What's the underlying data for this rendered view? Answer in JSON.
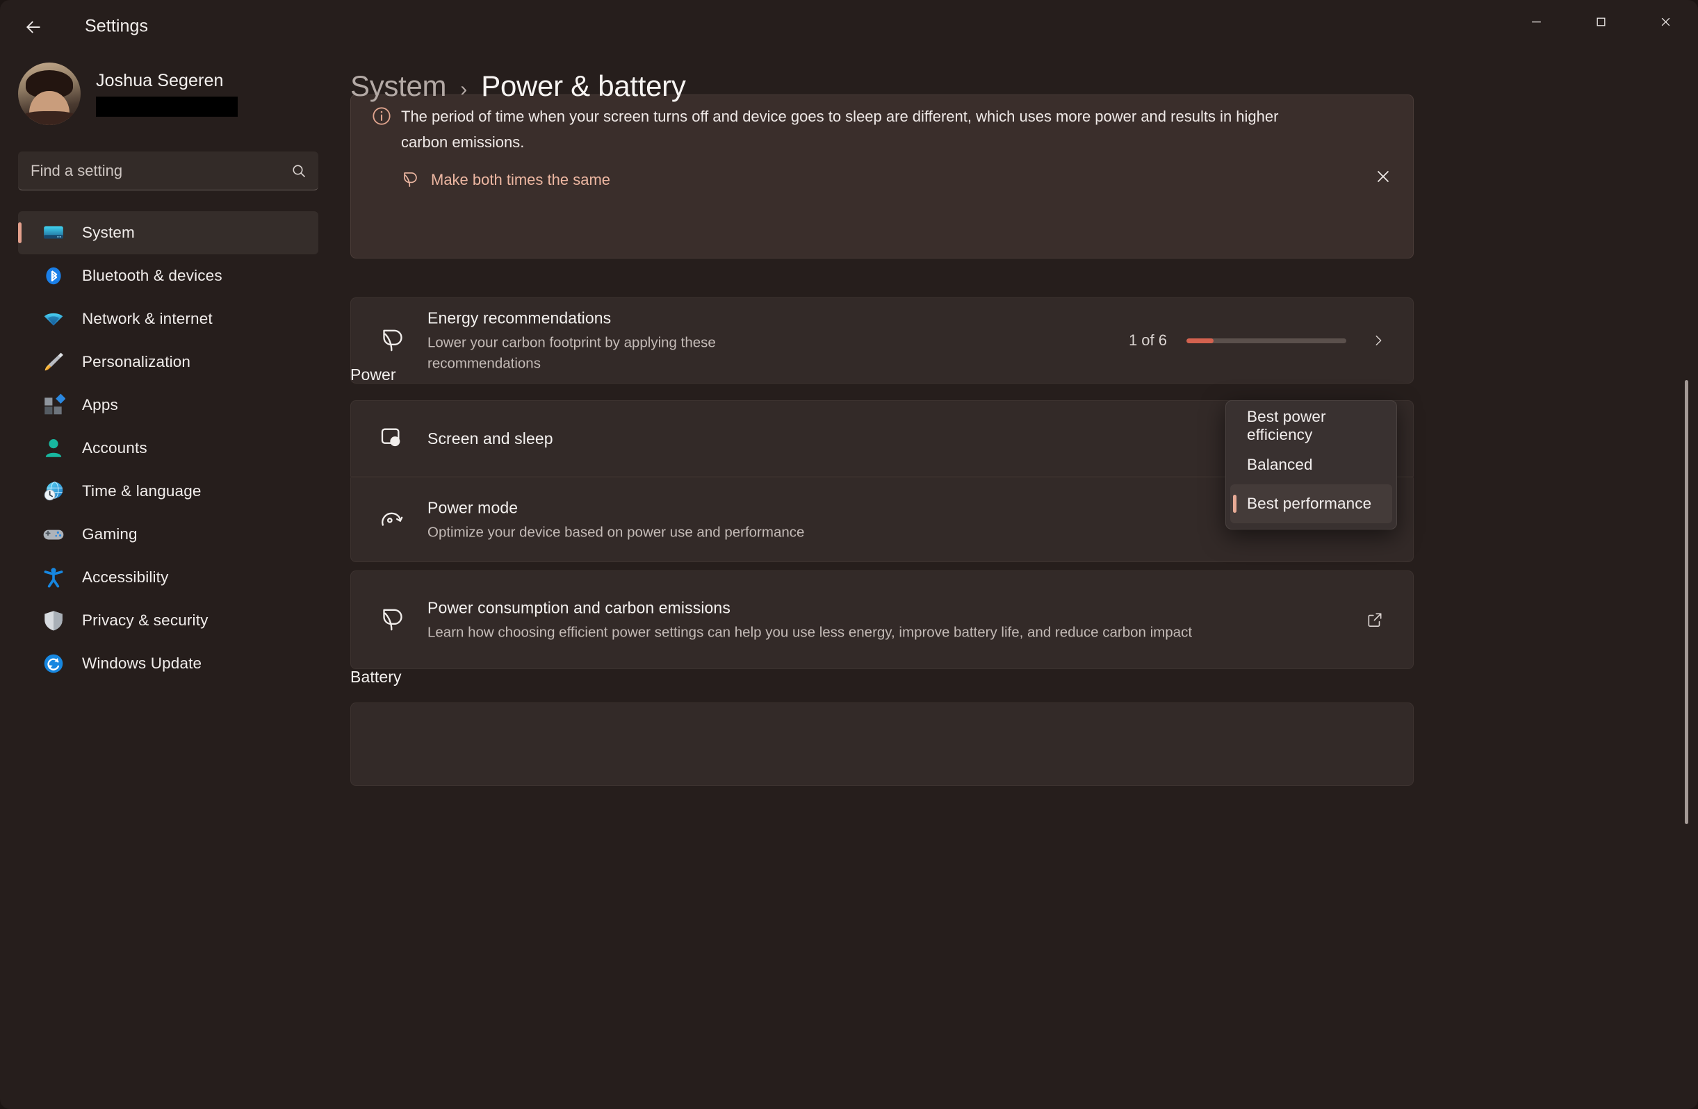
{
  "window": {
    "app_title": "Settings",
    "back_label": "Back",
    "minimize_label": "Minimize",
    "maximize_label": "Maximize",
    "close_label": "Close"
  },
  "colors": {
    "background": "#261e1c",
    "card": "#332a28",
    "accent": "#e3a08c",
    "progress_fill": "#d4624f",
    "info_link": "#edb7a2",
    "text_primary": "#f4f1ef",
    "text_secondary": "#c4bbb7"
  },
  "profile": {
    "name": "Joshua Segeren",
    "email_redacted": true
  },
  "search": {
    "placeholder": "Find a setting",
    "value": "",
    "icon": "search-icon"
  },
  "sidebar": {
    "items": [
      {
        "label": "System",
        "icon": "monitor-icon",
        "selected": true
      },
      {
        "label": "Bluetooth & devices",
        "icon": "bluetooth-icon",
        "selected": false
      },
      {
        "label": "Network & internet",
        "icon": "wifi-icon",
        "selected": false
      },
      {
        "label": "Personalization",
        "icon": "paintbrush-icon",
        "selected": false
      },
      {
        "label": "Apps",
        "icon": "apps-grid-icon",
        "selected": false
      },
      {
        "label": "Accounts",
        "icon": "person-icon",
        "selected": false
      },
      {
        "label": "Time & language",
        "icon": "clock-globe-icon",
        "selected": false
      },
      {
        "label": "Gaming",
        "icon": "gamepad-icon",
        "selected": false
      },
      {
        "label": "Accessibility",
        "icon": "accessibility-person-icon",
        "selected": false
      },
      {
        "label": "Privacy & security",
        "icon": "shield-icon",
        "selected": false
      },
      {
        "label": "Windows Update",
        "icon": "update-refresh-icon",
        "selected": false
      }
    ]
  },
  "breadcrumb": {
    "parent": "System",
    "separator": "›",
    "current": "Power & battery"
  },
  "infobar": {
    "icon": "info-icon",
    "message": "The period of time when your screen turns off and device goes to sleep are different, which uses more power and results in higher carbon emissions.",
    "action_label": "Make both times the same",
    "action_icon": "leaf-icon",
    "close_icon": "close-icon"
  },
  "energy_recommendations": {
    "icon": "leaf-icon",
    "title": "Energy recommendations",
    "subtitle": "Lower your carbon footprint by applying these recommendations",
    "progress_text": "1 of 6",
    "progress_applied": 1,
    "progress_total": 6,
    "progress_percent": 17,
    "chevron_icon": "chevron-right-icon"
  },
  "power_section": {
    "heading": "Power",
    "screen_and_sleep": {
      "icon": "screen-sleep-icon",
      "title": "Screen and sleep"
    },
    "power_mode": {
      "icon": "power-mode-icon",
      "title": "Power mode",
      "subtitle": "Optimize your device based on power use and performance",
      "selected_value": "Best performance"
    },
    "carbon": {
      "icon": "leaf-icon",
      "title": "Power consumption and carbon emissions",
      "subtitle": "Learn how choosing efficient power settings can help you use less energy, improve battery life, and reduce carbon impact",
      "external_icon": "external-link-icon"
    }
  },
  "power_mode_dropdown": {
    "open": true,
    "options": [
      {
        "label": "Best power efficiency",
        "selected": false
      },
      {
        "label": "Balanced",
        "selected": false
      },
      {
        "label": "Best performance",
        "selected": true
      }
    ]
  },
  "battery_section": {
    "heading": "Battery"
  },
  "scrollbar": {
    "orientation": "vertical",
    "thumb_top_percent": 31,
    "thumb_height_percent": 42
  }
}
